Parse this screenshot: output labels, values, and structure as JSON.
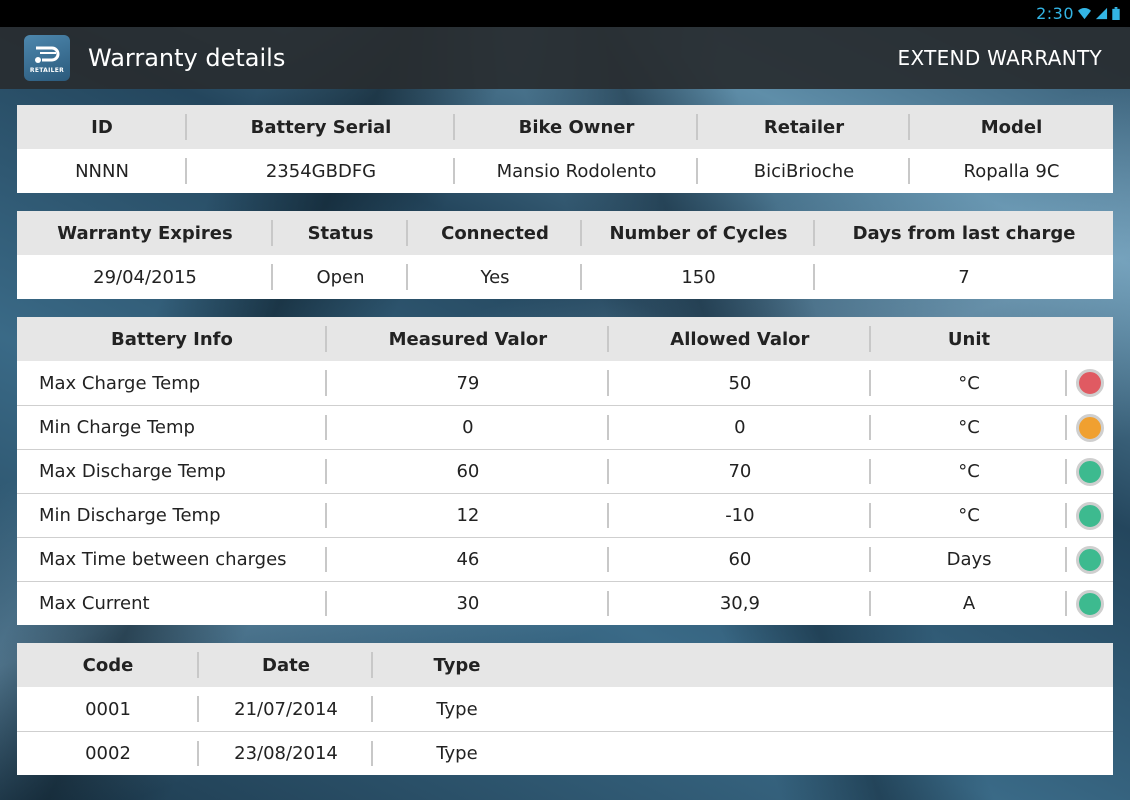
{
  "status_bar": {
    "time": "2:30"
  },
  "action_bar": {
    "logo_text": "RETAILER",
    "title": "Warranty details",
    "extend_label": "EXTEND WARRANTY"
  },
  "bike_table": {
    "headers": [
      "ID",
      "Battery Serial",
      "Bike Owner",
      "Retailer",
      "Model"
    ],
    "row": [
      "NNNN",
      "2354GBDFG",
      "Mansio Rodolento",
      "BiciBrioche",
      "Ropalla 9C"
    ]
  },
  "warranty_table": {
    "headers": [
      "Warranty Expires",
      "Status",
      "Connected",
      "Number of Cycles",
      "Days from last charge"
    ],
    "row": [
      "29/04/2015",
      "Open",
      "Yes",
      "150",
      "7"
    ]
  },
  "battery_table": {
    "headers": [
      "Battery Info",
      "Measured Valor",
      "Allowed Valor",
      "Unit"
    ],
    "rows": [
      {
        "info": "Max Charge Temp",
        "measured": "79",
        "allowed": "50",
        "unit": "°C",
        "status_color": "#e05a62"
      },
      {
        "info": "Min Charge Temp",
        "measured": "0",
        "allowed": "0",
        "unit": "°C",
        "status_color": "#f0a030"
      },
      {
        "info": "Max Discharge Temp",
        "measured": "60",
        "allowed": "70",
        "unit": "°C",
        "status_color": "#3dba8f"
      },
      {
        "info": "Min Discharge Temp",
        "measured": "12",
        "allowed": "-10",
        "unit": "°C",
        "status_color": "#3dba8f"
      },
      {
        "info": "Max Time between charges",
        "measured": "46",
        "allowed": "60",
        "unit": "Days",
        "status_color": "#3dba8f"
      },
      {
        "info": "Max Current",
        "measured": "30",
        "allowed": "30,9",
        "unit": "A",
        "status_color": "#3dba8f"
      }
    ]
  },
  "events_table": {
    "headers": [
      "Code",
      "Date",
      "Type"
    ],
    "rows": [
      {
        "code": "0001",
        "date": "21/07/2014",
        "type": "Type"
      },
      {
        "code": "0002",
        "date": "23/08/2014",
        "type": "Type"
      }
    ]
  }
}
